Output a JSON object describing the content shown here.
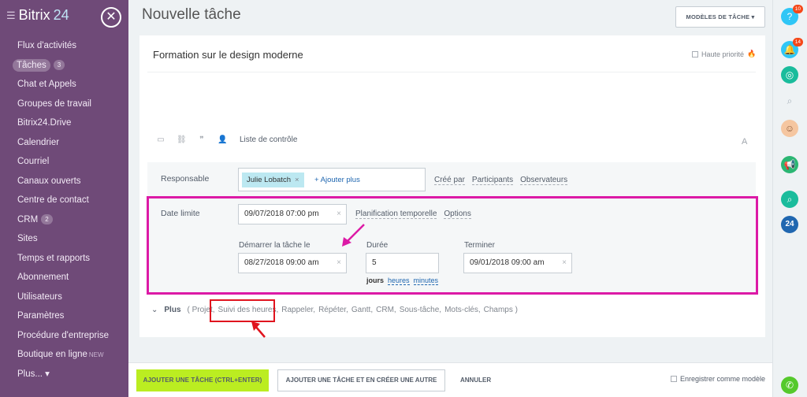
{
  "sidebar": {
    "logo_text": "Bitrix",
    "logo_number": "24",
    "items": [
      {
        "label": "Flux d'activités"
      },
      {
        "label": "Tâches",
        "count": "3"
      },
      {
        "label": "Chat et Appels"
      },
      {
        "label": "Groupes de travail"
      },
      {
        "label": "Bitrix24.Drive"
      },
      {
        "label": "Calendrier"
      },
      {
        "label": "Courriel"
      },
      {
        "label": "Canaux ouverts"
      },
      {
        "label": "Centre de contact"
      },
      {
        "label": "CRM",
        "count": "2"
      },
      {
        "label": "Sites"
      },
      {
        "label": "Temps et rapports"
      },
      {
        "label": "Abonnement"
      },
      {
        "label": "Utilisateurs"
      },
      {
        "label": "Paramètres"
      },
      {
        "label": "Procédure d'entreprise"
      },
      {
        "label": "Boutique en ligne",
        "badge": "NEW"
      },
      {
        "label": "Plus... ▾"
      }
    ]
  },
  "header": {
    "title": "Nouvelle tâche",
    "templates_button": "MODÈLES DE TÂCHE"
  },
  "task": {
    "title": "Formation sur le design moderne",
    "high_priority": "Haute priorité",
    "checklist": "Liste de contrôle",
    "font_button": "A"
  },
  "responsible": {
    "label": "Responsable",
    "person": "Julie Lobatch",
    "add_more": "+ Ajouter plus",
    "links": [
      "Créé par",
      "Participants",
      "Observateurs"
    ]
  },
  "deadline": {
    "label": "Date limite",
    "value": "09/07/2018 07:00 pm",
    "links": [
      "Planification temporelle",
      "Options"
    ],
    "start_label": "Démarrer la tâche le",
    "start_value": "08/27/2018 09:00 am",
    "duration_label": "Durée",
    "duration_value": "5",
    "end_label": "Terminer",
    "end_value": "09/01/2018 09:00 am",
    "units": [
      "jours",
      "heures",
      "minutes"
    ]
  },
  "more": {
    "label": "Plus",
    "items": [
      "( Projet,",
      "Suivi des heures,",
      "Rappeler,",
      "Répéter,",
      "Gantt,",
      "CRM,",
      "Sous-tâche,",
      "Mots-clés,",
      "Champs )"
    ]
  },
  "footer": {
    "add_task": "AJOUTER UNE TÂCHE (CTRL+ENTER)",
    "add_and_create": "AJOUTER UNE TÂCHE ET EN CRÉER UNE AUTRE",
    "cancel": "ANNULER",
    "save_template": "Enregistrer comme modèle"
  },
  "rightbar": {
    "help_badge": "10",
    "notif_badge": "14",
    "b24": "24"
  },
  "colors": {
    "sidebar": "#6f4a78",
    "primary_button": "#bbed21",
    "highlight_magenta": "#dc1aa6",
    "highlight_red": "#e0141e",
    "link": "#2067b0"
  }
}
